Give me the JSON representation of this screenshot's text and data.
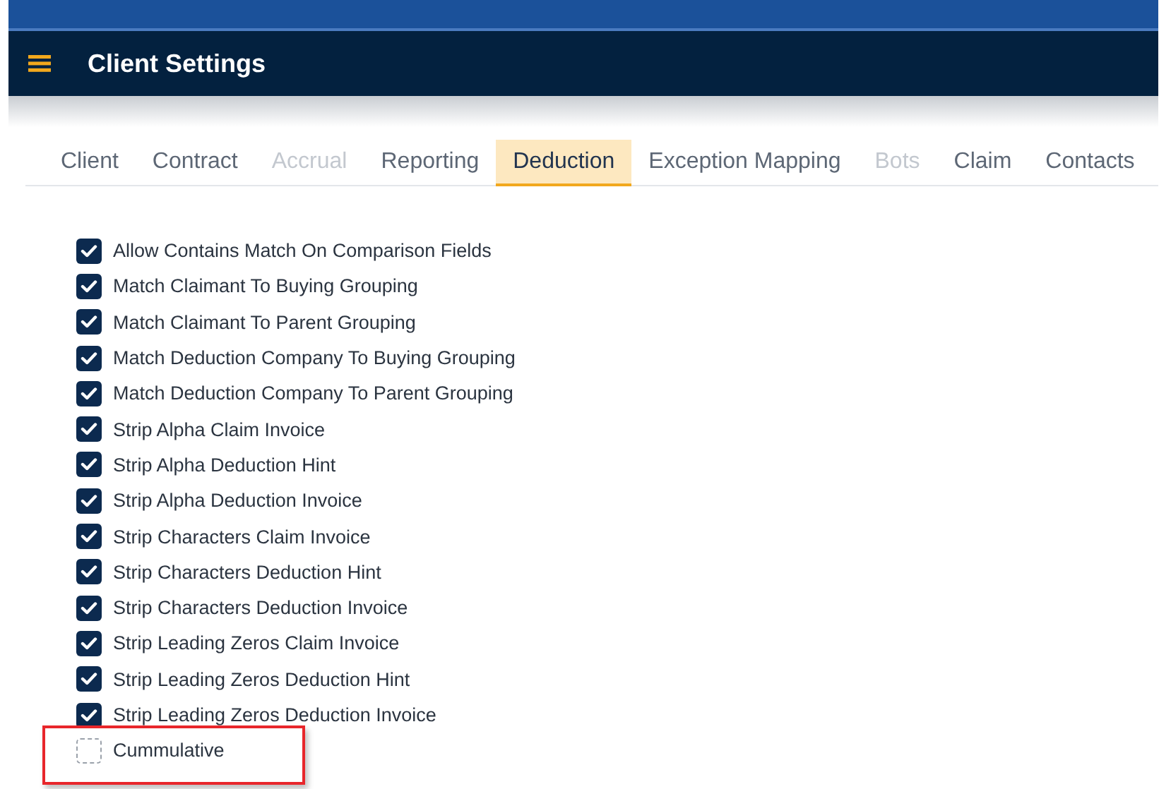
{
  "header": {
    "title": "Client Settings"
  },
  "tabs": [
    {
      "label": "Client",
      "selected": false,
      "disabled": false
    },
    {
      "label": "Contract",
      "selected": false,
      "disabled": false
    },
    {
      "label": "Accrual",
      "selected": false,
      "disabled": true
    },
    {
      "label": "Reporting",
      "selected": false,
      "disabled": false
    },
    {
      "label": "Deduction",
      "selected": true,
      "disabled": false
    },
    {
      "label": "Exception Mapping",
      "selected": false,
      "disabled": false
    },
    {
      "label": "Bots",
      "selected": false,
      "disabled": true
    },
    {
      "label": "Claim",
      "selected": false,
      "disabled": false
    },
    {
      "label": "Contacts",
      "selected": false,
      "disabled": false
    }
  ],
  "options": [
    {
      "label": "Allow Contains Match On Comparison Fields",
      "checked": true,
      "highlighted": false
    },
    {
      "label": "Match Claimant To Buying Grouping",
      "checked": true,
      "highlighted": false
    },
    {
      "label": "Match Claimant To Parent Grouping",
      "checked": true,
      "highlighted": false
    },
    {
      "label": "Match Deduction Company To Buying Grouping",
      "checked": true,
      "highlighted": false
    },
    {
      "label": "Match Deduction Company To Parent Grouping",
      "checked": true,
      "highlighted": false
    },
    {
      "label": "Strip Alpha Claim Invoice",
      "checked": true,
      "highlighted": false
    },
    {
      "label": "Strip Alpha Deduction Hint",
      "checked": true,
      "highlighted": false
    },
    {
      "label": "Strip Alpha Deduction Invoice",
      "checked": true,
      "highlighted": false
    },
    {
      "label": "Strip Characters Claim Invoice",
      "checked": true,
      "highlighted": false
    },
    {
      "label": "Strip Characters Deduction Hint",
      "checked": true,
      "highlighted": false
    },
    {
      "label": "Strip Characters Deduction Invoice",
      "checked": true,
      "highlighted": false
    },
    {
      "label": "Strip Leading Zeros Claim Invoice",
      "checked": true,
      "highlighted": false
    },
    {
      "label": "Strip Leading Zeros Deduction Hint",
      "checked": true,
      "highlighted": false
    },
    {
      "label": "Strip Leading Zeros Deduction Invoice",
      "checked": true,
      "highlighted": false
    },
    {
      "label": "Cummulative",
      "checked": false,
      "highlighted": true
    }
  ]
}
